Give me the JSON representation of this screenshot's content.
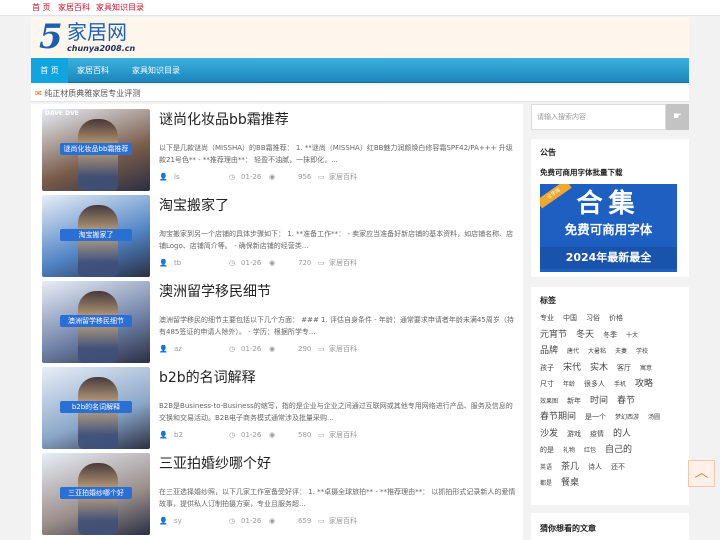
{
  "topbar": {
    "links": [
      "首 页",
      "家居百科",
      "家具知识目录"
    ]
  },
  "logo": {
    "mark": "5",
    "cn": "家居网",
    "en": "chunya2008.cn"
  },
  "nav": {
    "items": [
      "首 页",
      "家居百科",
      "家具知识目录"
    ]
  },
  "notice": {
    "text": "纯正材质典雅家居专业评测"
  },
  "posts": [
    {
      "title": "谜尚化妆品bb霜推荐",
      "excerpt": "以下是几款谜尚（MISSHA）的BB霜推荐： 1. **谜尚（MISSHA）红BB魅力润颜焕白修容霜SPF42/PA+++ 升级款21号色** - **推荐理由**： 轻盈不油腻，一抹即化，...",
      "author": "ls",
      "date": "01-26",
      "views": "956",
      "category": "家居百科",
      "thumb_label": "谜尚化妆品bb霜推荐",
      "thumb_tag": "DAVE DVE",
      "color": "#7a5c4a"
    },
    {
      "title": "淘宝搬家了",
      "excerpt": "淘宝搬家到另一个店铺的具体步骤如下： 1. **准备工作**： - 卖家应当准备好新店铺的基本资料，如店铺名称、店铺Logo、店铺简介等。 - 确保新店铺的经营类...",
      "author": "tb",
      "date": "01-26",
      "views": "720",
      "category": "家居百科",
      "thumb_label": "淘宝搬家了",
      "thumb_tag": "",
      "color": "#4f83c4"
    },
    {
      "title": "澳洲留学移民细节",
      "excerpt": "澳洲留学移民的细节主要包括以下几个方面： ### 1. 评估自身条件 - 年龄：通常要求申请者年龄未满45周岁（持有485签证的申请人除外）。 - 学历：根据所学专...",
      "author": "az",
      "date": "01-26",
      "views": "290",
      "category": "家居百科",
      "thumb_label": "澳洲留学移民细节",
      "thumb_tag": "",
      "color": "#6e7fa6"
    },
    {
      "title": "b2b的名词解释",
      "excerpt": "B2B是Business-to-Business的缩写，指的是企业与企业之间通过互联网或其他专用网络进行产品、服务及信息的交换和交易活动。B2B电子商务模式通常涉及批量采购...",
      "author": "b2",
      "date": "01-26",
      "views": "580",
      "category": "家居百科",
      "thumb_label": "b2b的名词解释",
      "thumb_tag": "",
      "color": "#8aa7c9"
    },
    {
      "title": "三亚拍婚纱哪个好",
      "excerpt": "在三亚选择婚纱照，以下几家工作室备受好评： 1. **卓摄全球旅拍** - **推荐理由**： 以抓拍形式记录新人的爱情故事，提供私人订制拍摄方案，专业且服务超...",
      "author": "sy",
      "date": "01-26",
      "views": "659",
      "category": "家居百科",
      "thumb_label": "三亚拍婚纱哪个好",
      "thumb_tag": "",
      "color": "#9a8e8a"
    }
  ],
  "sidebar": {
    "search_placeholder": "请输入搜索内容",
    "announce_title": "公告",
    "announce_sub": "免费可商用字体批量下载",
    "ad": {
      "ribbon": "全字库",
      "big": "合集",
      "mid": "免费可商用字体",
      "bot": "2024年最新最全"
    },
    "tags_title": "标签",
    "guess_title": "猜你想看的文章",
    "tags": [
      [
        "专业",
        "中国",
        "习俗",
        "价格"
      ],
      [
        "元宵节",
        "冬天",
        "冬季",
        "十大"
      ],
      [
        "品牌",
        "唐代",
        "大暑粘",
        "夫妻",
        "学校"
      ],
      [
        "孩子",
        "宋代",
        "实木",
        "客厅",
        "寓意"
      ],
      [
        "尺寸",
        "年龄",
        "很多人",
        "手机",
        "攻略"
      ],
      [
        "效果图",
        "新年",
        "时间",
        "春节"
      ],
      [
        "春节期间",
        "是一个",
        "梦幻西游",
        "汤圆"
      ],
      [
        "沙发",
        "游戏",
        "疫情",
        "的人"
      ],
      [
        "的是",
        "礼物",
        "红包",
        "自己的"
      ],
      [
        "英语",
        "茶几",
        "诗人",
        "还不"
      ],
      [
        "都是",
        "餐桌"
      ]
    ]
  }
}
